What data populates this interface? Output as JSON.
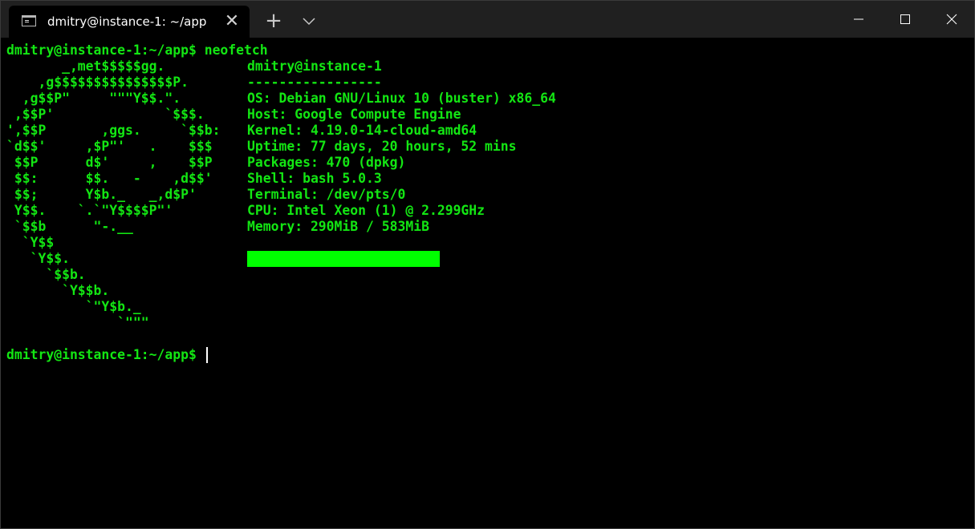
{
  "window": {
    "tab_title": "dmitry@instance-1: ~/app",
    "icons": {
      "tab": "terminal-icon",
      "tab_close": "close-icon",
      "new_tab": "plus-icon",
      "dropdown": "chevron-down-icon",
      "minimize": "minimize-icon",
      "maximize": "maximize-icon",
      "close": "close-icon"
    },
    "glyphs": {
      "tab_close": "✕",
      "new_tab": "+"
    }
  },
  "terminal": {
    "prompt_command": "dmitry@instance-1:~/app$ neofetch",
    "logo_lines": [
      "       _,met$$$$$gg.",
      "    ,g$$$$$$$$$$$$$$$P.",
      "  ,g$$P\"     \"\"\"Y$$.\".",
      " ,$$P'              `$$$.",
      "',$$P       ,ggs.     `$$b:",
      "`d$$'     ,$P\"'   .    $$$",
      " $$P      d$'     ,    $$P",
      " $$:      $$.   -    ,d$$'",
      " $$;      Y$b._   _,d$P'",
      " Y$$.    `.`\"Y$$$$P\"'",
      " `$$b      \"-.__",
      "  `Y$$",
      "   `Y$$.",
      "     `$$b.",
      "       `Y$$b.",
      "          `\"Y$b._",
      "              `\"\"\""
    ],
    "info": {
      "user_host": "dmitry@instance-1",
      "separator": "-----------------",
      "os": "OS: Debian GNU/Linux 10 (buster) x86_64",
      "host": "Host: Google Compute Engine",
      "kernel": "Kernel: 4.19.0-14-cloud-amd64",
      "uptime": "Uptime: 77 days, 20 hours, 52 mins",
      "packages": "Packages: 470 (dpkg)",
      "shell": "Shell: bash 5.0.3",
      "terminal": "Terminal: /dev/pts/0",
      "cpu": "CPU: Intel Xeon (1) @ 2.299GHz",
      "memory": "Memory: 290MiB / 583MiB"
    },
    "prompt_current": "dmitry@instance-1:~/app$ "
  },
  "colors": {
    "text": "#13e613",
    "color_block": "#00ff00",
    "background": "#000000",
    "titlebar": "#202020",
    "cursor": "#ffffff"
  }
}
